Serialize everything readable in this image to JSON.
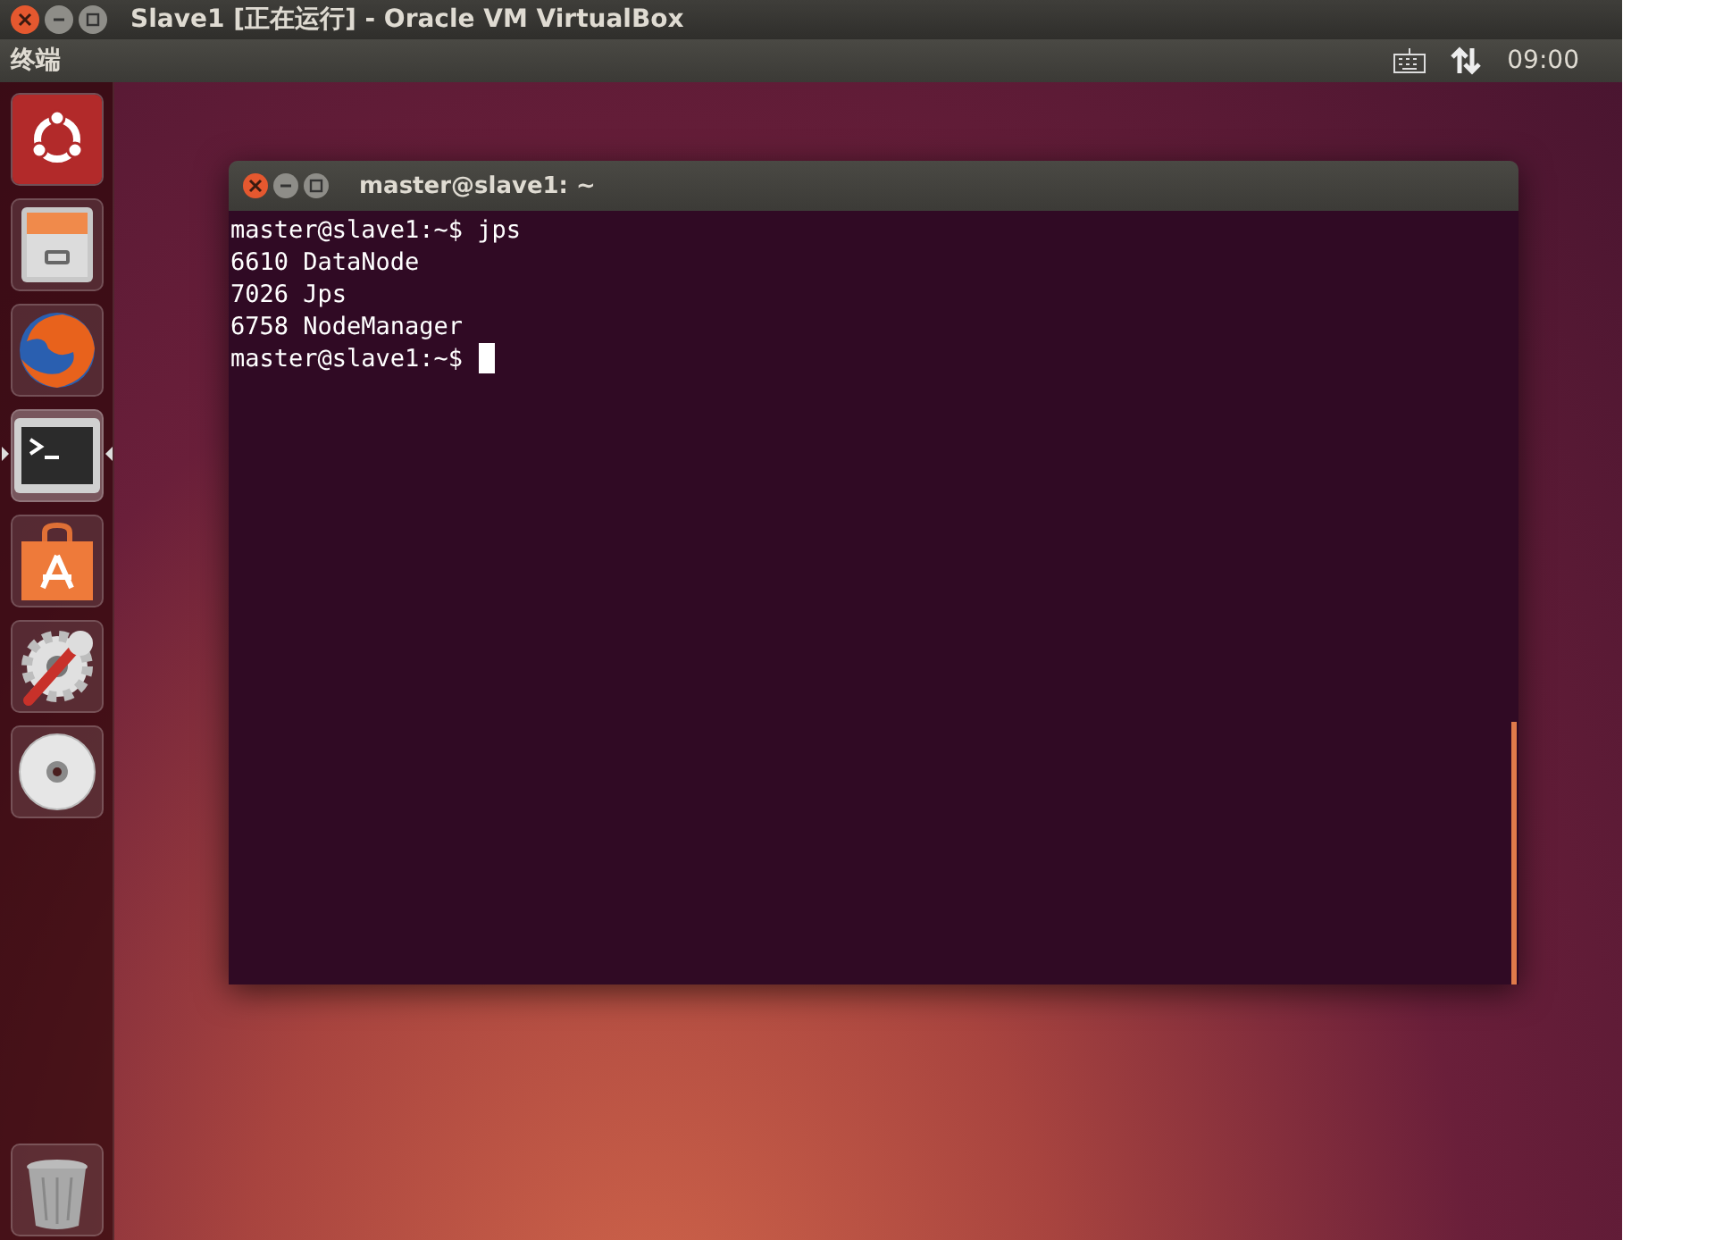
{
  "vm_window": {
    "title": "Slave1 [正在运行] - Oracle VM VirtualBox"
  },
  "top_panel": {
    "app_name": "终端",
    "clock": "09:00"
  },
  "launcher": {
    "items": [
      {
        "kind": "dash",
        "selected": false
      },
      {
        "kind": "files",
        "selected": false
      },
      {
        "kind": "browser",
        "selected": false
      },
      {
        "kind": "terminal",
        "selected": true
      },
      {
        "kind": "store",
        "selected": false
      },
      {
        "kind": "settings",
        "selected": false
      },
      {
        "kind": "disc",
        "selected": false
      }
    ],
    "trash": {
      "kind": "trash"
    }
  },
  "terminal": {
    "title": "master@slave1: ~",
    "lines": [
      {
        "text": "master@slave1:~$ jps",
        "cursor": false
      },
      {
        "text": "6610 DataNode",
        "cursor": false
      },
      {
        "text": "7026 Jps",
        "cursor": false
      },
      {
        "text": "6758 NodeManager",
        "cursor": false
      },
      {
        "text": "master@slave1:~$ ",
        "cursor": true
      }
    ]
  }
}
